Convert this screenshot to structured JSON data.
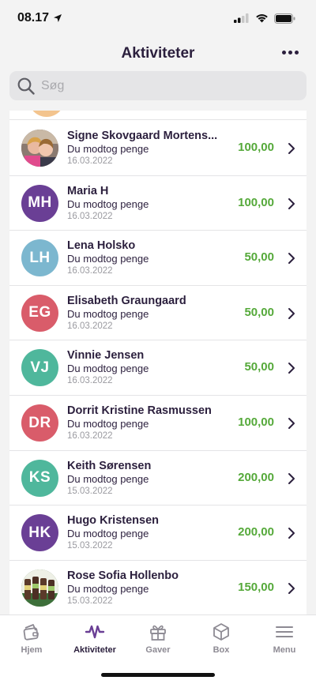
{
  "status": {
    "time": "08.17"
  },
  "header": {
    "title": "Aktiviteter"
  },
  "search": {
    "placeholder": "Søg"
  },
  "colors": {
    "amount": "#55a93a",
    "purple": "#6a3f95",
    "teal": "#4fb79c",
    "blue": "#7cb7cf",
    "red": "#d95c6a"
  },
  "activities": [
    {
      "name": "Signe Skovgaard Mortens...",
      "initials": "",
      "avatar_color": "#8b7a70",
      "photo": true,
      "photo_kind": "portrait",
      "description": "Du modtog penge",
      "date": "16.03.2022",
      "amount": "100,00"
    },
    {
      "name": "Maria H",
      "initials": "MH",
      "avatar_color": "#6a3f95",
      "photo": false,
      "description": "Du modtog penge",
      "date": "16.03.2022",
      "amount": "100,00"
    },
    {
      "name": "Lena Holsko",
      "initials": "LH",
      "avatar_color": "#7cb7cf",
      "photo": false,
      "description": "Du modtog penge",
      "date": "16.03.2022",
      "amount": "50,00"
    },
    {
      "name": "Elisabeth Graungaard",
      "initials": "EG",
      "avatar_color": "#d95c6a",
      "photo": false,
      "description": "Du modtog penge",
      "date": "16.03.2022",
      "amount": "50,00"
    },
    {
      "name": "Vinnie Jensen",
      "initials": "VJ",
      "avatar_color": "#4fb79c",
      "photo": false,
      "description": "Du modtog penge",
      "date": "16.03.2022",
      "amount": "50,00"
    },
    {
      "name": "Dorrit Kristine Rasmussen",
      "initials": "DR",
      "avatar_color": "#d95c6a",
      "photo": false,
      "description": "Du modtog penge",
      "date": "16.03.2022",
      "amount": "100,00"
    },
    {
      "name": "Keith Sørensen",
      "initials": "KS",
      "avatar_color": "#4fb79c",
      "photo": false,
      "description": "Du modtog penge",
      "date": "15.03.2022",
      "amount": "200,00"
    },
    {
      "name": "Hugo Kristensen",
      "initials": "HK",
      "avatar_color": "#6a3f95",
      "photo": false,
      "description": "Du modtog penge",
      "date": "15.03.2022",
      "amount": "200,00"
    },
    {
      "name": "Rose Sofia Hollenbo",
      "initials": "",
      "avatar_color": "#3f6b3a",
      "photo": true,
      "photo_kind": "bottles",
      "description": "Du modtog penge",
      "date": "15.03.2022",
      "amount": "150,00"
    }
  ],
  "tabs": [
    {
      "label": "Hjem",
      "icon": "wallet-icon",
      "active": false
    },
    {
      "label": "Aktiviteter",
      "icon": "activity-wave-icon",
      "active": true
    },
    {
      "label": "Gaver",
      "icon": "gift-icon",
      "active": false
    },
    {
      "label": "Box",
      "icon": "box-icon",
      "active": false
    },
    {
      "label": "Menu",
      "icon": "menu-icon",
      "active": false
    }
  ]
}
